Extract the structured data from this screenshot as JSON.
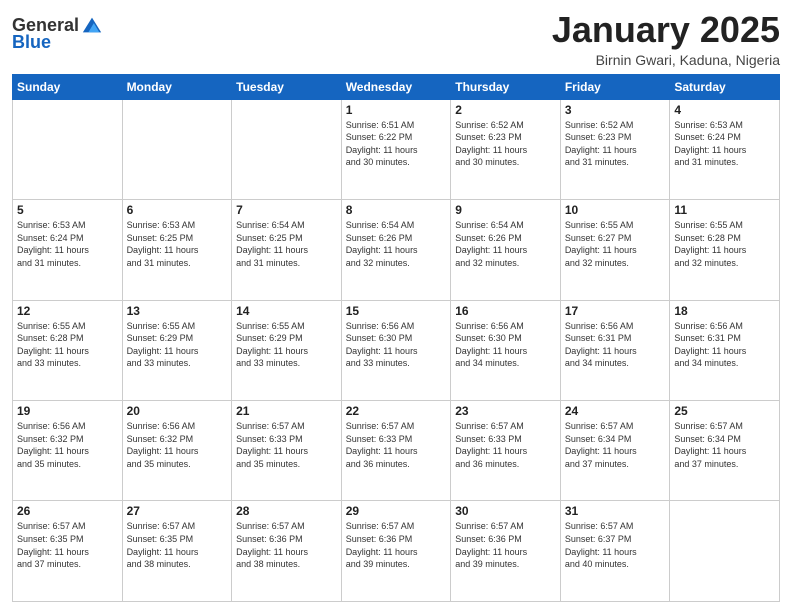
{
  "header": {
    "logo_general": "General",
    "logo_blue": "Blue",
    "month_title": "January 2025",
    "subtitle": "Birnin Gwari, Kaduna, Nigeria"
  },
  "weekdays": [
    "Sunday",
    "Monday",
    "Tuesday",
    "Wednesday",
    "Thursday",
    "Friday",
    "Saturday"
  ],
  "weeks": [
    [
      {
        "day": "",
        "info": ""
      },
      {
        "day": "",
        "info": ""
      },
      {
        "day": "",
        "info": ""
      },
      {
        "day": "1",
        "info": "Sunrise: 6:51 AM\nSunset: 6:22 PM\nDaylight: 11 hours\nand 30 minutes."
      },
      {
        "day": "2",
        "info": "Sunrise: 6:52 AM\nSunset: 6:23 PM\nDaylight: 11 hours\nand 30 minutes."
      },
      {
        "day": "3",
        "info": "Sunrise: 6:52 AM\nSunset: 6:23 PM\nDaylight: 11 hours\nand 31 minutes."
      },
      {
        "day": "4",
        "info": "Sunrise: 6:53 AM\nSunset: 6:24 PM\nDaylight: 11 hours\nand 31 minutes."
      }
    ],
    [
      {
        "day": "5",
        "info": "Sunrise: 6:53 AM\nSunset: 6:24 PM\nDaylight: 11 hours\nand 31 minutes."
      },
      {
        "day": "6",
        "info": "Sunrise: 6:53 AM\nSunset: 6:25 PM\nDaylight: 11 hours\nand 31 minutes."
      },
      {
        "day": "7",
        "info": "Sunrise: 6:54 AM\nSunset: 6:25 PM\nDaylight: 11 hours\nand 31 minutes."
      },
      {
        "day": "8",
        "info": "Sunrise: 6:54 AM\nSunset: 6:26 PM\nDaylight: 11 hours\nand 32 minutes."
      },
      {
        "day": "9",
        "info": "Sunrise: 6:54 AM\nSunset: 6:26 PM\nDaylight: 11 hours\nand 32 minutes."
      },
      {
        "day": "10",
        "info": "Sunrise: 6:55 AM\nSunset: 6:27 PM\nDaylight: 11 hours\nand 32 minutes."
      },
      {
        "day": "11",
        "info": "Sunrise: 6:55 AM\nSunset: 6:28 PM\nDaylight: 11 hours\nand 32 minutes."
      }
    ],
    [
      {
        "day": "12",
        "info": "Sunrise: 6:55 AM\nSunset: 6:28 PM\nDaylight: 11 hours\nand 33 minutes."
      },
      {
        "day": "13",
        "info": "Sunrise: 6:55 AM\nSunset: 6:29 PM\nDaylight: 11 hours\nand 33 minutes."
      },
      {
        "day": "14",
        "info": "Sunrise: 6:55 AM\nSunset: 6:29 PM\nDaylight: 11 hours\nand 33 minutes."
      },
      {
        "day": "15",
        "info": "Sunrise: 6:56 AM\nSunset: 6:30 PM\nDaylight: 11 hours\nand 33 minutes."
      },
      {
        "day": "16",
        "info": "Sunrise: 6:56 AM\nSunset: 6:30 PM\nDaylight: 11 hours\nand 34 minutes."
      },
      {
        "day": "17",
        "info": "Sunrise: 6:56 AM\nSunset: 6:31 PM\nDaylight: 11 hours\nand 34 minutes."
      },
      {
        "day": "18",
        "info": "Sunrise: 6:56 AM\nSunset: 6:31 PM\nDaylight: 11 hours\nand 34 minutes."
      }
    ],
    [
      {
        "day": "19",
        "info": "Sunrise: 6:56 AM\nSunset: 6:32 PM\nDaylight: 11 hours\nand 35 minutes."
      },
      {
        "day": "20",
        "info": "Sunrise: 6:56 AM\nSunset: 6:32 PM\nDaylight: 11 hours\nand 35 minutes."
      },
      {
        "day": "21",
        "info": "Sunrise: 6:57 AM\nSunset: 6:33 PM\nDaylight: 11 hours\nand 35 minutes."
      },
      {
        "day": "22",
        "info": "Sunrise: 6:57 AM\nSunset: 6:33 PM\nDaylight: 11 hours\nand 36 minutes."
      },
      {
        "day": "23",
        "info": "Sunrise: 6:57 AM\nSunset: 6:33 PM\nDaylight: 11 hours\nand 36 minutes."
      },
      {
        "day": "24",
        "info": "Sunrise: 6:57 AM\nSunset: 6:34 PM\nDaylight: 11 hours\nand 37 minutes."
      },
      {
        "day": "25",
        "info": "Sunrise: 6:57 AM\nSunset: 6:34 PM\nDaylight: 11 hours\nand 37 minutes."
      }
    ],
    [
      {
        "day": "26",
        "info": "Sunrise: 6:57 AM\nSunset: 6:35 PM\nDaylight: 11 hours\nand 37 minutes."
      },
      {
        "day": "27",
        "info": "Sunrise: 6:57 AM\nSunset: 6:35 PM\nDaylight: 11 hours\nand 38 minutes."
      },
      {
        "day": "28",
        "info": "Sunrise: 6:57 AM\nSunset: 6:36 PM\nDaylight: 11 hours\nand 38 minutes."
      },
      {
        "day": "29",
        "info": "Sunrise: 6:57 AM\nSunset: 6:36 PM\nDaylight: 11 hours\nand 39 minutes."
      },
      {
        "day": "30",
        "info": "Sunrise: 6:57 AM\nSunset: 6:36 PM\nDaylight: 11 hours\nand 39 minutes."
      },
      {
        "day": "31",
        "info": "Sunrise: 6:57 AM\nSunset: 6:37 PM\nDaylight: 11 hours\nand 40 minutes."
      },
      {
        "day": "",
        "info": ""
      }
    ]
  ]
}
